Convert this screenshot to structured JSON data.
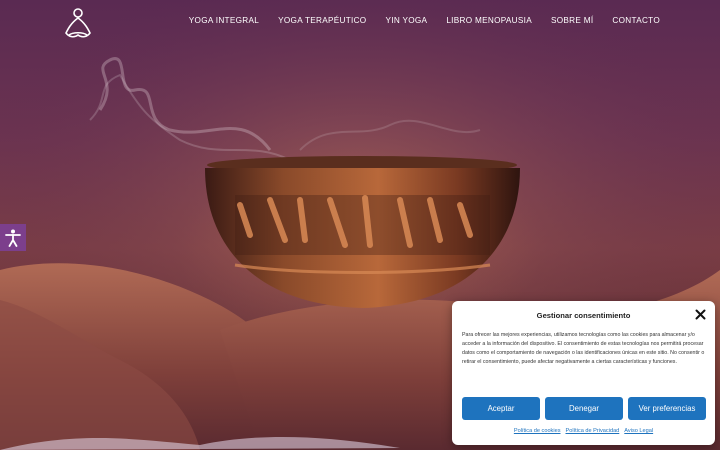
{
  "header": {
    "logo": "meditation-figure-logo",
    "nav": [
      {
        "label": "YOGA INTEGRAL"
      },
      {
        "label": "YOGA TERAPÉUTICO"
      },
      {
        "label": "YIN YOGA"
      },
      {
        "label": "LIBRO MENOPAUSIA"
      },
      {
        "label": "SOBRE MÍ"
      },
      {
        "label": "CONTACTO"
      }
    ]
  },
  "hero": {
    "image": "tibetan-singing-bowl-with-incense-smoke"
  },
  "accessibility": {
    "icon": "accessibility-person-icon",
    "color": "#7c3f8c"
  },
  "consent": {
    "title": "Gestionar consentimiento",
    "body": "Para ofrecer las mejores experiencias, utilizamos tecnologías como las cookies para almacenar y/o acceder a la información del dispositivo. El consentimiento de estas tecnologías nos permitirá procesar datos como el comportamiento de navegación o las identificaciones únicas en este sitio. No consentir o retirar el consentimiento, puede afectar negativamente a ciertas características y funciones.",
    "buttons": {
      "accept": "Aceptar",
      "deny": "Denegar",
      "preferences": "Ver preferencias"
    },
    "links": {
      "cookies": "Política de cookies",
      "privacy": "Política de Privacidad",
      "legal": "Aviso Legal"
    },
    "accent": "#1e73be"
  }
}
